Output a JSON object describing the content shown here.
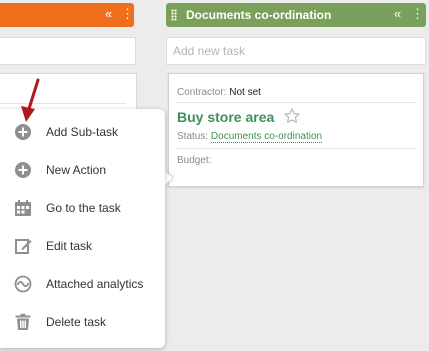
{
  "left_column": {
    "collapse_icon": "«",
    "menu_icon": "⋮"
  },
  "right_column": {
    "title": "Documents co-ordination",
    "collapse_icon": "«",
    "menu_icon": "⋮",
    "add_task_placeholder": "Add new task",
    "card": {
      "contractor_label": "Contractor:",
      "contractor_value": "Not set",
      "task_name": "Buy store area",
      "status_label": "Status:",
      "status_value": "Documents co-ordination",
      "budget_label": "Budget:"
    }
  },
  "context_menu": {
    "items": [
      {
        "label": "Add Sub-task",
        "icon": "plus-circle-icon"
      },
      {
        "label": "New Action",
        "icon": "plus-circle-icon"
      },
      {
        "label": "Go to the task",
        "icon": "go-to-task-icon"
      },
      {
        "label": "Edit task",
        "icon": "edit-icon"
      },
      {
        "label": "Attached analytics",
        "icon": "analytics-icon"
      },
      {
        "label": "Delete task",
        "icon": "trash-icon"
      }
    ]
  },
  "colors": {
    "left_header": "#ef6f1f",
    "right_header": "#7aa05c",
    "task_link": "#3c9157",
    "annotation_arrow": "#b0181b"
  }
}
